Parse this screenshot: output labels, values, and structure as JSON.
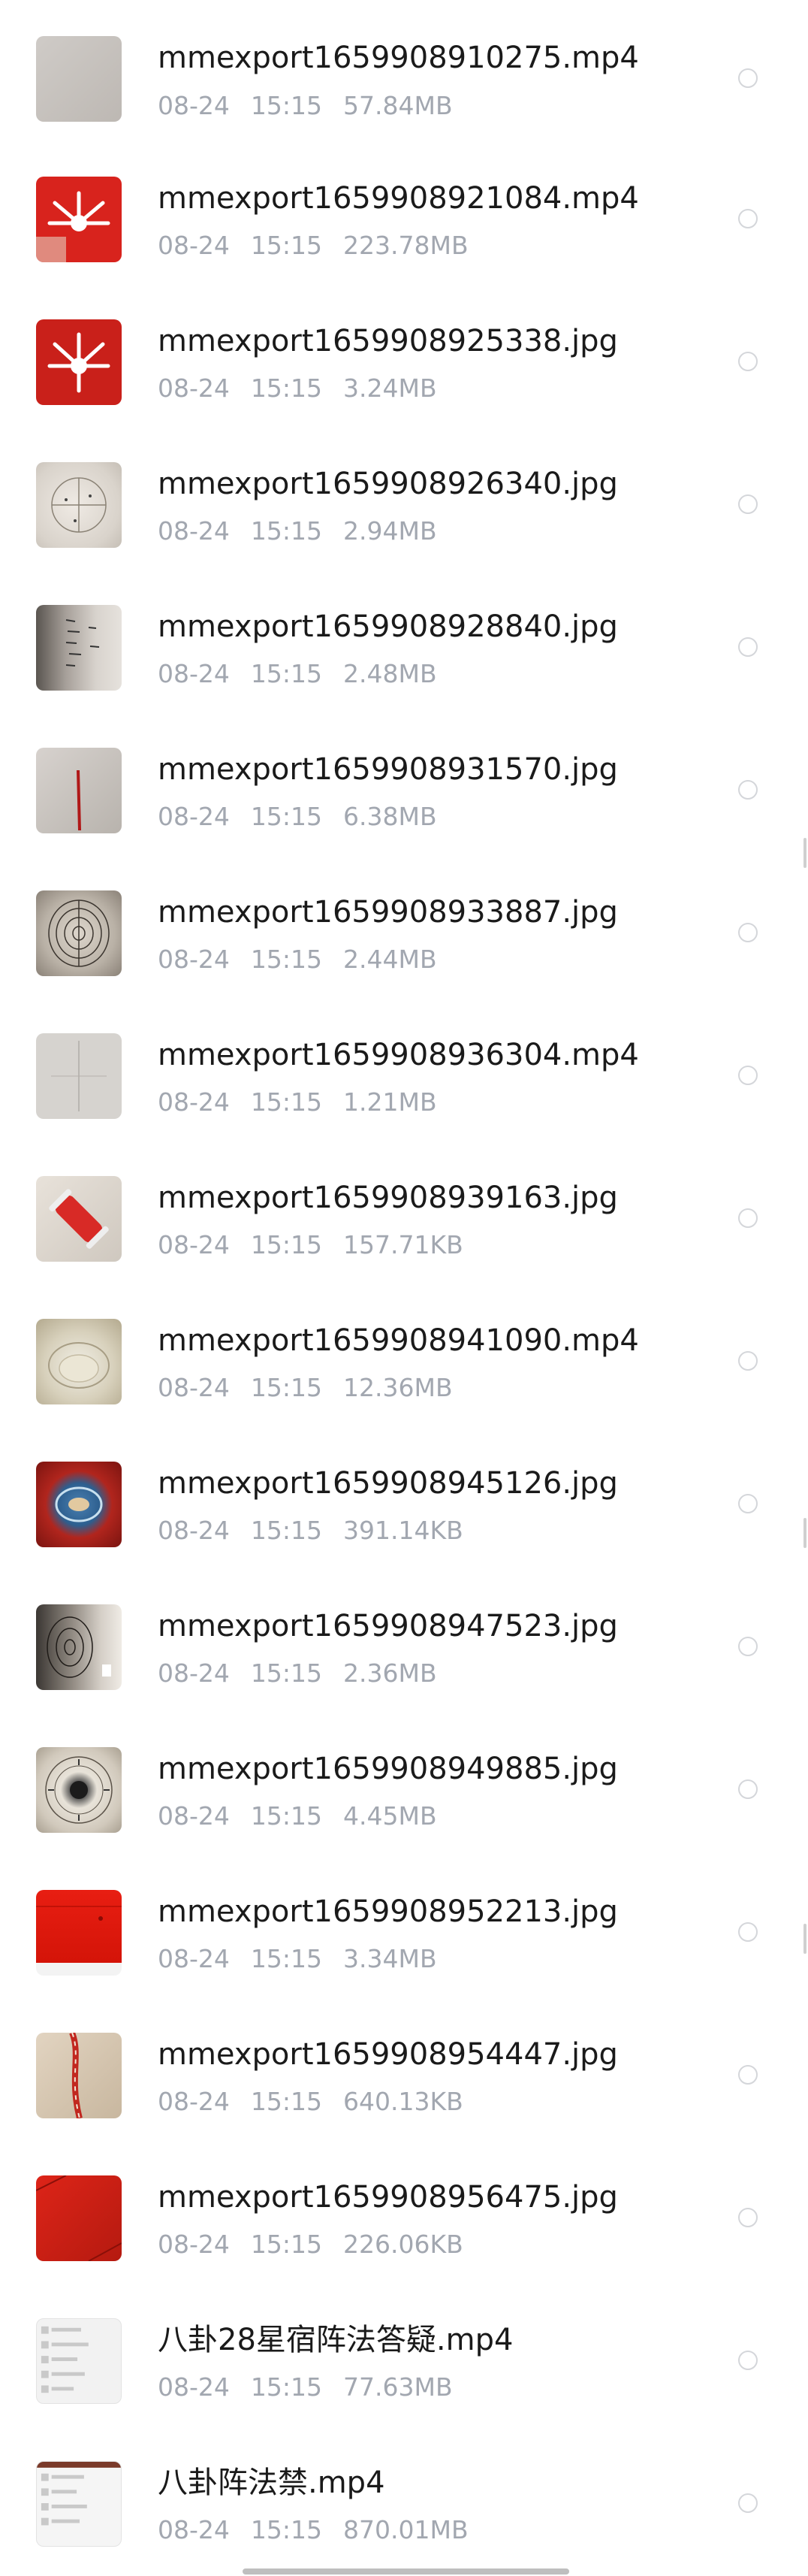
{
  "files": [
    {
      "name": "mmexport1659908910275.mp4",
      "date": "08-24",
      "time": "15:15",
      "size": "57.84MB",
      "thumb_icon": "gray-wall-thumbnail"
    },
    {
      "name": "mmexport1659908921084.mp4",
      "date": "08-24",
      "time": "15:15",
      "size": "223.78MB",
      "thumb_icon": "red-logo-thumbnail"
    },
    {
      "name": "mmexport1659908925338.jpg",
      "date": "08-24",
      "time": "15:15",
      "size": "3.24MB",
      "thumb_icon": "red-logo-thumbnail"
    },
    {
      "name": "mmexport1659908926340.jpg",
      "date": "08-24",
      "time": "15:15",
      "size": "2.94MB",
      "thumb_icon": "paper-diagram-thumbnail"
    },
    {
      "name": "mmexport1659908928840.jpg",
      "date": "08-24",
      "time": "15:15",
      "size": "2.48MB",
      "thumb_icon": "paper-writing-thumbnail"
    },
    {
      "name": "mmexport1659908931570.jpg",
      "date": "08-24",
      "time": "15:15",
      "size": "6.38MB",
      "thumb_icon": "wall-line-thumbnail"
    },
    {
      "name": "mmexport1659908933887.jpg",
      "date": "08-24",
      "time": "15:15",
      "size": "2.44MB",
      "thumb_icon": "circle-diagram-thumbnail"
    },
    {
      "name": "mmexport1659908936304.mp4",
      "date": "08-24",
      "time": "15:15",
      "size": "1.21MB",
      "thumb_icon": "gray-wall-thumbnail"
    },
    {
      "name": "mmexport1659908939163.jpg",
      "date": "08-24",
      "time": "15:15",
      "size": "157.71KB",
      "thumb_icon": "thread-spool-thumbnail"
    },
    {
      "name": "mmexport1659908941090.mp4",
      "date": "08-24",
      "time": "15:15",
      "size": "12.36MB",
      "thumb_icon": "glass-bowl-thumbnail"
    },
    {
      "name": "mmexport1659908945126.jpg",
      "date": "08-24",
      "time": "15:15",
      "size": "391.14KB",
      "thumb_icon": "red-plate-thumbnail"
    },
    {
      "name": "mmexport1659908947523.jpg",
      "date": "08-24",
      "time": "15:15",
      "size": "2.36MB",
      "thumb_icon": "dark-diagram-thumbnail"
    },
    {
      "name": "mmexport1659908949885.jpg",
      "date": "08-24",
      "time": "15:15",
      "size": "4.45MB",
      "thumb_icon": "bagua-chart-thumbnail"
    },
    {
      "name": "mmexport1659908952213.jpg",
      "date": "08-24",
      "time": "15:15",
      "size": "3.34MB",
      "thumb_icon": "red-box-thumbnail"
    },
    {
      "name": "mmexport1659908954447.jpg",
      "date": "08-24",
      "time": "15:15",
      "size": "640.13KB",
      "thumb_icon": "red-rope-thumbnail"
    },
    {
      "name": "mmexport1659908956475.jpg",
      "date": "08-24",
      "time": "15:15",
      "size": "226.06KB",
      "thumb_icon": "red-fabric-thumbnail"
    },
    {
      "name": "八卦28星宿阵法答疑.mp4",
      "date": "08-24",
      "time": "15:15",
      "size": "77.63MB",
      "thumb_icon": "screenshot-thumbnail"
    },
    {
      "name": "八卦阵法禁.mp4",
      "date": "08-24",
      "time": "15:15",
      "size": "870.01MB",
      "thumb_icon": "screenshot-thumbnail"
    }
  ]
}
